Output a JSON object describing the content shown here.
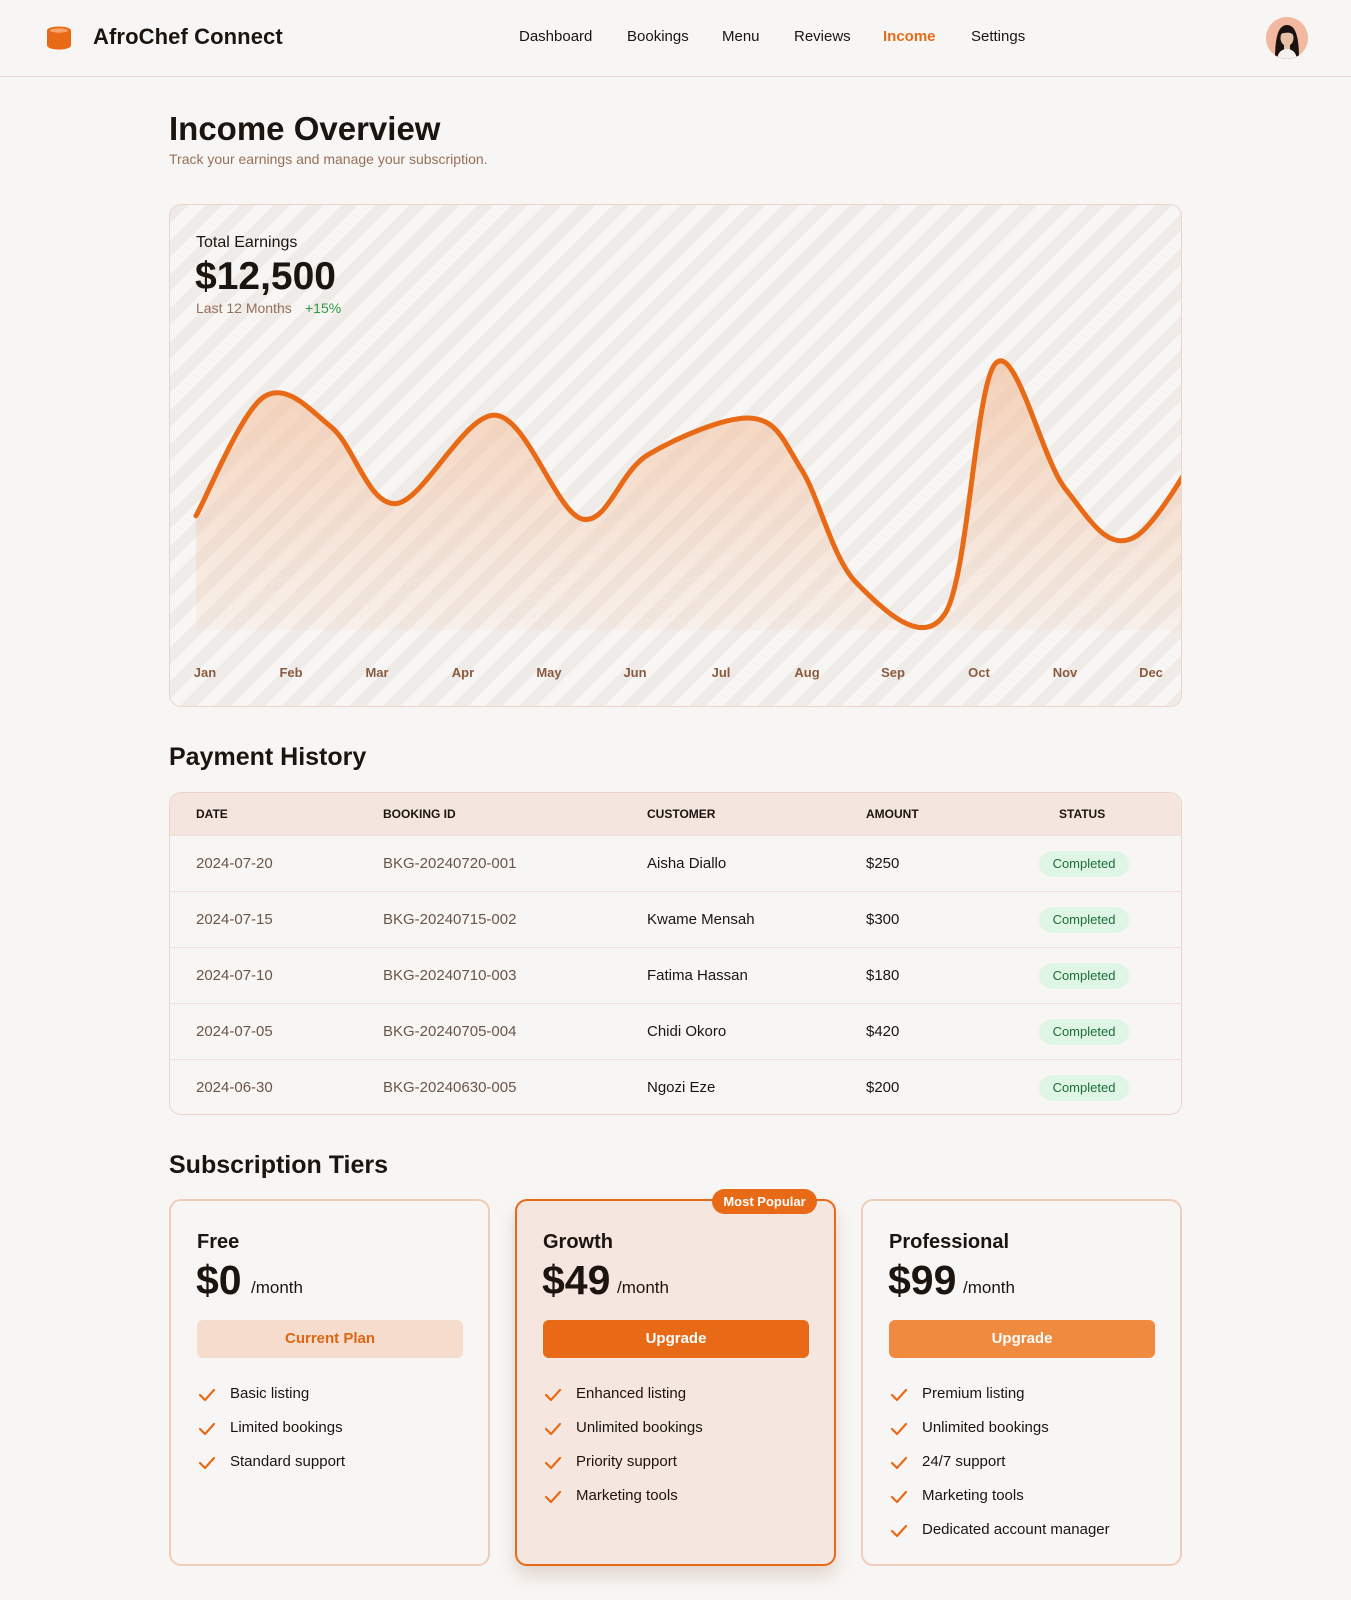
{
  "app": {
    "title": "AfroChef Connect"
  },
  "nav": {
    "items": [
      {
        "label": "Dashboard",
        "active": false
      },
      {
        "label": "Bookings",
        "active": false
      },
      {
        "label": "Menu",
        "active": false
      },
      {
        "label": "Reviews",
        "active": false
      },
      {
        "label": "Income",
        "active": true
      },
      {
        "label": "Settings",
        "active": false
      }
    ],
    "avatar_icon": "user-avatar-icon"
  },
  "page": {
    "title": "Income Overview",
    "subtitle": "Track your earnings and manage your subscription."
  },
  "earnings": {
    "label": "Total Earnings",
    "value": "$12,500",
    "period": "Last 12 Months",
    "change": "+15%",
    "change_color": "#2e9a44"
  },
  "chart_data": {
    "type": "area",
    "categories": [
      "Jan",
      "Feb",
      "Mar",
      "Apr",
      "May",
      "Jun",
      "Jul",
      "Aug",
      "Sep",
      "Oct",
      "Nov",
      "Dec"
    ],
    "values": [
      44,
      83,
      73,
      48,
      77,
      43,
      64,
      76,
      59,
      22,
      12,
      94,
      53,
      37,
      83
    ],
    "x_positions": [
      0,
      0.78,
      1.56,
      2.3,
      3.45,
      4.44,
      5.2,
      6.4,
      6.97,
      7.6,
      8.62,
      9.2,
      10.0,
      10.8,
      11.9
    ],
    "ylim": [
      0,
      100
    ],
    "line_color": "#e86a16",
    "fill_color": "#f3c4a4",
    "grid": false,
    "title": "",
    "xlabel": "",
    "ylabel": ""
  },
  "payments": {
    "title": "Payment History",
    "columns": [
      "Date",
      "Booking ID",
      "Customer",
      "Amount",
      "Status"
    ],
    "rows": [
      {
        "date": "2024-07-20",
        "booking_id": "BKG-20240720-001",
        "customer": "Aisha Diallo",
        "amount": "$250",
        "status": "Completed"
      },
      {
        "date": "2024-07-15",
        "booking_id": "BKG-20240715-002",
        "customer": "Kwame Mensah",
        "amount": "$300",
        "status": "Completed"
      },
      {
        "date": "2024-07-10",
        "booking_id": "BKG-20240710-003",
        "customer": "Fatima Hassan",
        "amount": "$180",
        "status": "Completed"
      },
      {
        "date": "2024-07-05",
        "booking_id": "BKG-20240705-004",
        "customer": "Chidi Okoro",
        "amount": "$420",
        "status": "Completed"
      },
      {
        "date": "2024-06-30",
        "booking_id": "BKG-20240630-005",
        "customer": "Ngozi Eze",
        "amount": "$200",
        "status": "Completed"
      }
    ]
  },
  "tiers": {
    "title": "Subscription Tiers",
    "items": [
      {
        "name": "Free",
        "price": "$0",
        "period": "/month",
        "button": "Current Plan",
        "features": [
          "Basic listing",
          "Limited bookings",
          "Standard support"
        ]
      },
      {
        "name": "Growth",
        "price": "$49",
        "period": "/month",
        "button": "Upgrade",
        "badge": "Most Popular",
        "features": [
          "Enhanced listing",
          "Unlimited bookings",
          "Priority support",
          "Marketing tools"
        ]
      },
      {
        "name": "Professional",
        "price": "$99",
        "period": "/month",
        "button": "Upgrade",
        "features": [
          "Premium listing",
          "Unlimited bookings",
          "24/7 support",
          "Marketing tools",
          "Dedicated account manager"
        ]
      }
    ]
  },
  "colors": {
    "accent": "#e86a16",
    "background": "#f8f6f4",
    "muted_text": "#96705a"
  }
}
